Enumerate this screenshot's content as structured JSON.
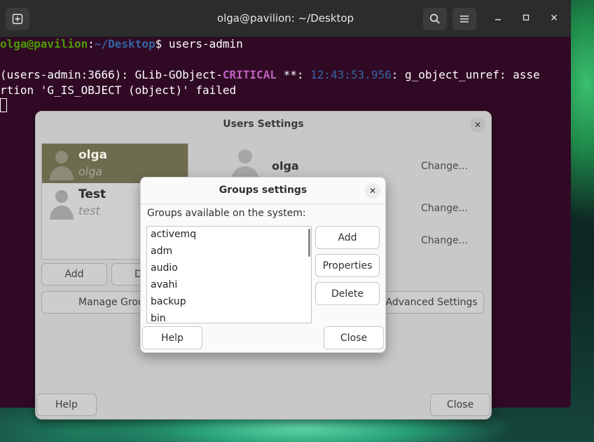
{
  "terminal": {
    "title": "olga@pavilion: ~/Desktop",
    "prompt_user": "olga@pavilion",
    "prompt_sep": ":",
    "prompt_path": "~/Desktop",
    "prompt_dollar": "$ ",
    "command": "users-admin",
    "err_prefix": "(users-admin:3666): GLib-GObject-",
    "err_level": "CRITICAL",
    "err_stars": " **: ",
    "err_time": "12:43:53.956",
    "err_rest": ": g_object_unref: asse",
    "err_line2": "rtion 'G_IS_OBJECT (object)' failed",
    "icons": [
      "new-tab-icon",
      "search-icon",
      "menu-icon",
      "minimize-icon",
      "maximize-icon",
      "close-icon"
    ]
  },
  "users_dialog": {
    "title": "Users Settings",
    "users": [
      {
        "name": "olga",
        "login": "olga",
        "selected": true
      },
      {
        "name": "Test",
        "login": "test",
        "selected": false
      }
    ],
    "selected_user": "olga",
    "change_labels": [
      "Change...",
      "Change...",
      "Change..."
    ],
    "add_label": "Add",
    "delete_label": "D",
    "manage_groups_label": "Manage Grou",
    "advanced_label": "Advanced Settings",
    "help_label": "Help",
    "close_label": "Close"
  },
  "groups_dialog": {
    "title": "Groups settings",
    "available_label": "Groups available on the system:",
    "groups": [
      "activemq",
      "adm",
      "audio",
      "avahi",
      "backup",
      "bin"
    ],
    "add_label": "Add",
    "properties_label": "Properties",
    "delete_label": "Delete",
    "help_label": "Help",
    "close_label": "Close"
  }
}
